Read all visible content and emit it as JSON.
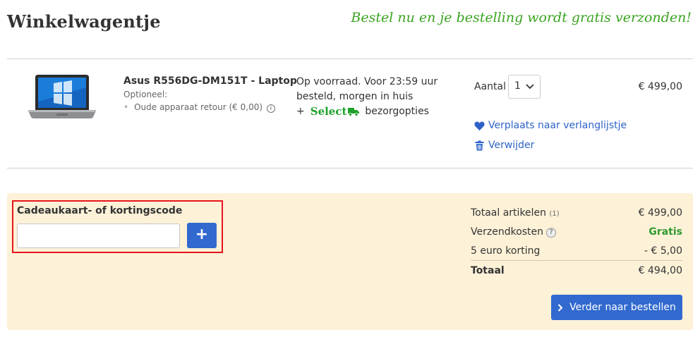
{
  "header": {
    "title": "Winkelwagentje",
    "promo": "Bestel nu en je bestelling wordt gratis verzonden!"
  },
  "cart_item": {
    "image_icon": "laptop-image",
    "name": "Asus R556DG-DM151T - Laptop",
    "optional_label": "Optioneel:",
    "option": "Oude apparaat retour (€ 0,00)",
    "stock_text": "Op voorraad. Voor 23:59 uur besteld, morgen in huis",
    "select_prefix": "+",
    "select_brand": "Select",
    "delivery_options": "bezorgopties",
    "quantity_label": "Aantal",
    "quantity_value": "1",
    "price": "€ 499,00",
    "wishlist_link": "Verplaats naar verlanglijstje",
    "remove_link": "Verwijder"
  },
  "discount": {
    "label": "Cadeaukaart- of kortingscode",
    "input_value": "",
    "add_button": "+"
  },
  "summary": {
    "items_label": "Totaal artikelen",
    "items_count": "(1)",
    "items_value": "€ 499,00",
    "shipping_label": "Verzendkosten",
    "shipping_value": "Gratis",
    "discount_label": "5 euro korting",
    "discount_value": "- € 5,00",
    "total_label": "Totaal",
    "total_value": "€ 494,00"
  },
  "checkout": {
    "button_label": "Verder naar bestellen"
  },
  "colors": {
    "accent_blue": "#3169cf",
    "link_blue": "#2d63c8",
    "promo_green": "#3aa320",
    "panel_bg": "#fdf2d8",
    "highlight_red": "#e6141c"
  }
}
